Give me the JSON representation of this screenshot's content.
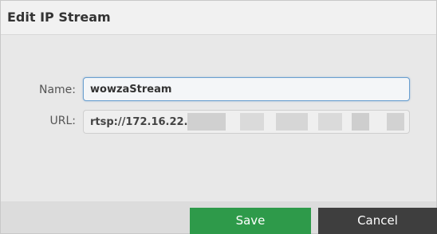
{
  "dialog": {
    "title": "Edit IP Stream"
  },
  "form": {
    "name_label": "Name:",
    "name_value": "wowzaStream",
    "url_label": "URL:",
    "url_value": "rtsp://172.16.22."
  },
  "footer": {
    "save_label": "Save",
    "cancel_label": "Cancel"
  },
  "colors": {
    "save": "#2e9a4a",
    "cancel": "#3e3e3e",
    "focus_border": "#6a9fcf"
  }
}
